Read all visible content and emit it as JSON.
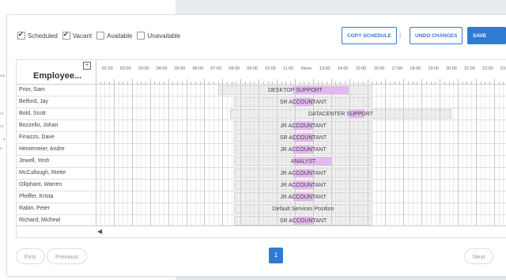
{
  "filters": [
    {
      "label": "Scheduled",
      "checked": true
    },
    {
      "label": "Vacant",
      "checked": true
    },
    {
      "label": "Available",
      "checked": false
    },
    {
      "label": "Unavailable",
      "checked": false
    }
  ],
  "buttons": {
    "copy": "COPY SCHEDULE",
    "separator": "|",
    "undo": "UNDO CHANGES",
    "save": "SAVE CHANGES"
  },
  "grid": {
    "employee_header": "Employee...",
    "expand_symbol": "+",
    "hours": [
      "01:00",
      "02:00",
      "03:00",
      "04:00",
      "05:00",
      "06:00",
      "07:00",
      "08:00",
      "09:00",
      "10:00",
      "11:00",
      "Noon",
      "13:00",
      "14:00",
      "15:00",
      "16:00",
      "17:00",
      "18:00",
      "19:00",
      "20:00",
      "21:00",
      "22:00",
      "23:"
    ],
    "rows": [
      {
        "name": "Prior, Sam",
        "shift": "DESKTOP SUPPORT"
      },
      {
        "name": "Belford, Jay",
        "shift": "SR ACCOUNTANT"
      },
      {
        "name": "Bold, Scott",
        "shift": "DATACENTER SUPPORT"
      },
      {
        "name": "Bozzello, Johan",
        "shift": "JR ACCOUNTANT"
      },
      {
        "name": "Finazzo, Dave",
        "shift": "SR ACCOUNTANT"
      },
      {
        "name": "Heinemeier, Andre",
        "shift": "JR ACCOUNTANT"
      },
      {
        "name": "Jewell, Yesh",
        "shift": "ANALYST"
      },
      {
        "name": "McCullough, Riette",
        "shift": "JR ACCOUNTANT"
      },
      {
        "name": "Olliphant, Warren",
        "shift": "JR ACCOUNTANT"
      },
      {
        "name": "Pfeiffer, Krista",
        "shift": "JR ACCOUNTANT"
      },
      {
        "name": "Rabin, Peter",
        "shift": "Default Services Position"
      },
      {
        "name": "Richard, Micheal",
        "shift": "SR ACCOUNTANT"
      }
    ],
    "scroll_left_symbol": "◀"
  },
  "pagination": {
    "first": "First",
    "previous": "Previous",
    "current": "1",
    "next": "Next"
  },
  "background_panel": {
    "fragments": [
      "WE",
      "ST",
      "ST",
      "A",
      "D"
    ]
  },
  "colors": {
    "accent": "#2f7bd2",
    "highlight": "#e3b8f0",
    "bar": "#eeeeee"
  }
}
